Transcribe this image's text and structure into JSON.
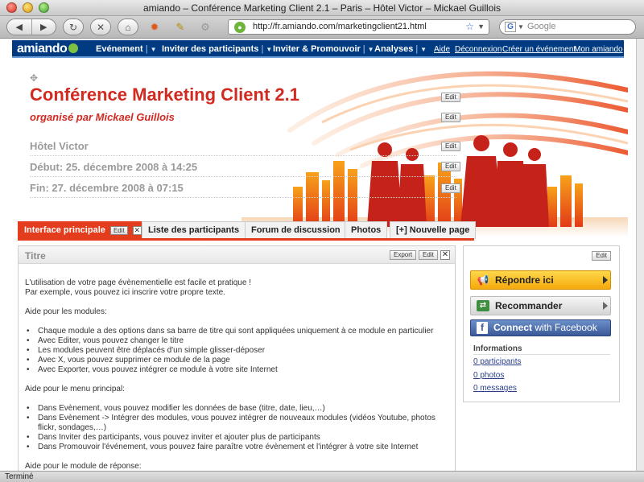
{
  "window": {
    "title": "amiando – Conférence Marketing Client 2.1 – Paris – Hôtel Victor – Mickael Guillois"
  },
  "browser": {
    "url": "http://fr.amiando.com/marketingclient21.html",
    "search_placeholder": "Google",
    "status": "Terminé"
  },
  "site_nav": {
    "logo": "amiando",
    "menus": [
      {
        "label": "Evénement",
        "sep": "|"
      },
      {
        "label": "Inviter des participants",
        "sep": "|"
      },
      {
        "label": "Inviter & Promouvoir",
        "sep": "|"
      },
      {
        "label": "Analyses",
        "sep": "|"
      }
    ],
    "links": [
      "Aide",
      "Déconnexion",
      "Créer un événement",
      "Mon amiando"
    ]
  },
  "header": {
    "title": "Conférence Marketing Client 2.1",
    "organizer": "organisé par Mickael Guillois",
    "venue": "Hôtel Victor",
    "start": "Début: 25. décembre 2008 à 14:25",
    "end": "Fin: 27. décembre 2008 à 07:15",
    "edit_label": "Edit"
  },
  "tabs": [
    {
      "label": "Interface principale",
      "active": true
    },
    {
      "label": "Liste des participants",
      "active": false
    },
    {
      "label": "Forum de discussion",
      "active": false
    },
    {
      "label": "Photos",
      "active": false
    },
    {
      "label": "[+] Nouvelle page",
      "active": false
    }
  ],
  "tab_edit_label": "Edit",
  "close_glyph": "✕",
  "module": {
    "title": "Titre",
    "export_label": "Export",
    "edit_label": "Edit",
    "intro": [
      "L'utilisation de votre page évènementielle est facile et pratique !",
      "Par exemple, vous pouvez ici inscrire votre propre texte."
    ],
    "modules_heading": "Aide pour les modules:",
    "modules_items": [
      "Chaque module a des options dans sa barre de titre qui sont appliquées uniquement à ce module en particulier",
      "Avec Editer, vous pouvez changer le titre",
      "Les modules peuvent être déplacés d'un simple glisser-déposer",
      "Avec X, vous pouvez supprimer ce module de la page",
      "Avec Exporter, vous pouvez intégrer ce module à votre site Internet"
    ],
    "menu_heading": "Aide pour le menu principal:",
    "menu_items": [
      "Dans Evènement, vous pouvez modifier les données de base (titre, date, lieu,…)",
      "Dans Evènement -> Intégrer des modules, vous pouvez intégrer de nouveaux modules (vidéos Youtube, photos flickr, sondages,…)",
      "Dans Inviter des participants, vous pouvez inviter et ajouter plus de participants",
      "Dans Promouvoir l'événement, vous pouvez faire paraître votre évènement et l'intégrer à votre site Internet"
    ],
    "response_heading": "Aide pour le module de réponse:"
  },
  "side": {
    "edit_label": "Edit",
    "respond_label": "Répondre ici",
    "recommend_label": "Recommander",
    "facebook_connect": "Connect",
    "facebook_with": " with Facebook",
    "info_title": "Informations",
    "info_links": [
      "0 participants",
      "0 photos",
      "0 messages"
    ]
  },
  "colors": {
    "brand_red": "#d12a21",
    "nav_blue": "#003b82",
    "tab_active": "#e33d1e",
    "facebook": "#3b5998"
  }
}
